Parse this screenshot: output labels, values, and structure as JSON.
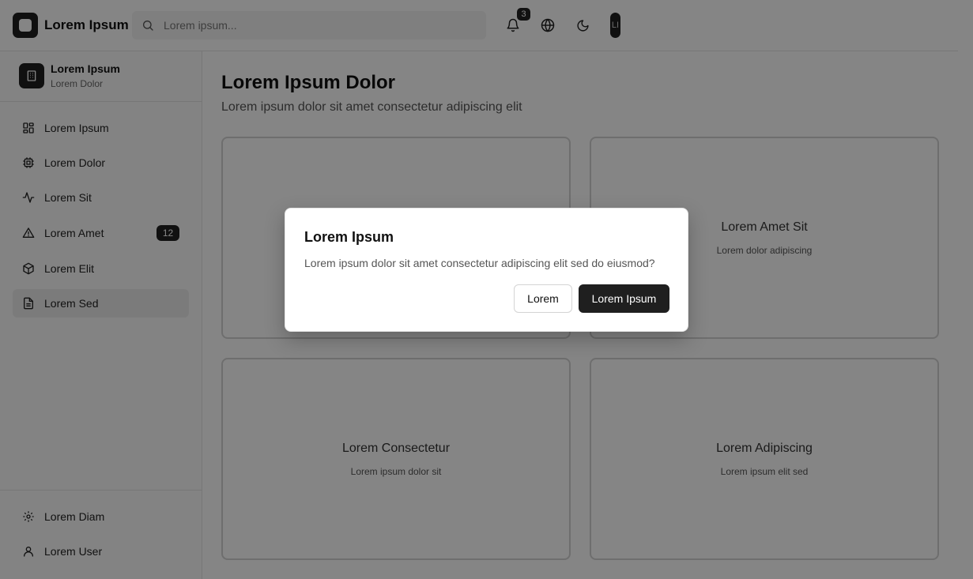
{
  "header": {
    "app_name": "Lorem Ipsum",
    "search_placeholder": "Lorem ipsum...",
    "notification_count": "3",
    "avatar_initials": "LI",
    "icons": [
      "logo-icon",
      "search-icon",
      "bell-icon",
      "globe-icon",
      "moon-icon"
    ]
  },
  "sidebar": {
    "workspace": {
      "name": "Lorem Ipsum",
      "subtitle": "Lorem Dolor"
    },
    "items": [
      {
        "label": "Lorem Ipsum",
        "icon": "dashboard-icon"
      },
      {
        "label": "Lorem Dolor",
        "icon": "chip-icon"
      },
      {
        "label": "Lorem Sit",
        "icon": "activity-icon"
      },
      {
        "label": "Lorem Amet",
        "icon": "warning-icon",
        "badge": "12"
      },
      {
        "label": "Lorem Elit",
        "icon": "box-icon"
      },
      {
        "label": "Lorem Sed",
        "icon": "file-icon",
        "active": true
      }
    ],
    "bottom_items": [
      {
        "label": "Lorem Diam",
        "icon": "gear-icon"
      },
      {
        "label": "Lorem User",
        "icon": "user-icon"
      }
    ]
  },
  "main": {
    "title": "Lorem Ipsum Dolor",
    "subtitle": "Lorem ipsum dolor sit amet consectetur adipiscing elit",
    "cards": [
      {
        "title": "",
        "subtitle": ""
      },
      {
        "title": "Lorem Amet Sit",
        "subtitle": "Lorem dolor adipiscing"
      },
      {
        "title": "Lorem Consectetur",
        "subtitle": "Lorem ipsum dolor sit"
      },
      {
        "title": "Lorem Adipiscing",
        "subtitle": "Lorem ipsum elit sed"
      }
    ]
  },
  "dialog": {
    "title": "Lorem Ipsum",
    "message": "Lorem ipsum dolor sit amet consectetur adipiscing elit sed do eiusmod?",
    "cancel_label": "Lorem",
    "confirm_label": "Lorem Ipsum"
  },
  "colors": {
    "primary": "#1f1f1f",
    "overlay": "rgba(0,0,0,0.48)",
    "border": "#d4d4d4"
  }
}
